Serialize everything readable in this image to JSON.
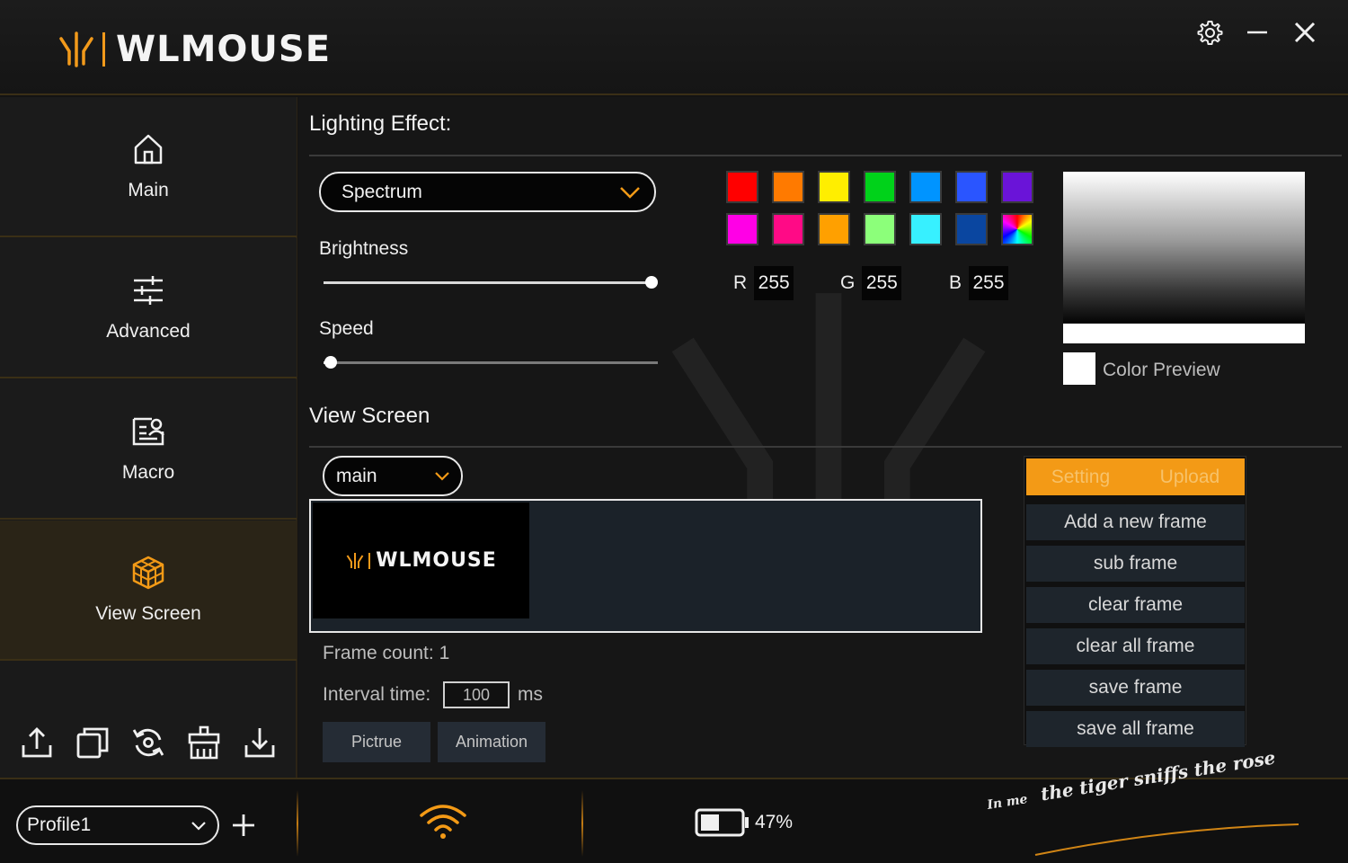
{
  "header": {
    "brand": "WLMOUSE",
    "settings_icon": "gear-icon",
    "minimize_icon": "minimize-icon",
    "close_icon": "close-icon"
  },
  "sidebar": {
    "items": [
      {
        "label": "Main",
        "icon": "home-icon",
        "active": false
      },
      {
        "label": "Advanced",
        "icon": "sliders-icon",
        "active": false
      },
      {
        "label": "Macro",
        "icon": "macro-icon",
        "active": false
      },
      {
        "label": "View Screen",
        "icon": "cube-icon",
        "active": true
      }
    ],
    "tools": [
      "export-icon",
      "copy-icon",
      "reset-icon",
      "clean-icon",
      "import-icon"
    ]
  },
  "lighting": {
    "title": "Lighting Effect:",
    "effect_value": "Spectrum",
    "brightness_label": "Brightness",
    "brightness_value": 1.0,
    "speed_label": "Speed",
    "speed_value": 0.02,
    "swatches": [
      "#ff0000",
      "#ff7a00",
      "#ffee00",
      "#00d21a",
      "#0094ff",
      "#2a55ff",
      "#6a14d8",
      "#ff00e6",
      "#ff0a86",
      "#ffa000",
      "#8cff7a",
      "#37f0ff",
      "#0a46a0",
      "rainbow"
    ],
    "r_label": "R",
    "r_value": "255",
    "g_label": "G",
    "g_value": "255",
    "b_label": "B",
    "b_value": "255",
    "preview_label": "Color Preview",
    "preview_color": "#ffffff"
  },
  "view_screen": {
    "title": "View Screen",
    "screen_select": "main",
    "canvas_brand": "WLMOUSE",
    "frame_count_label": "Frame count:",
    "frame_count": "1",
    "interval_label": "Interval time:",
    "interval_value": "100",
    "interval_unit": "ms",
    "picture_button": "Pictrue",
    "animation_button": "Animation",
    "tabs": [
      "Setting",
      "Upload"
    ],
    "actions": [
      "Add a new frame",
      "sub frame",
      "clear frame",
      "clear all frame",
      "save frame",
      "save all frame"
    ]
  },
  "footer": {
    "profile": "Profile1",
    "battery_text": "47%",
    "battery_level": 0.47,
    "slogan_left": "In me",
    "slogan_right": "the tiger sniffs the rose"
  },
  "colors": {
    "accent": "#f39a16",
    "background": "#161616"
  }
}
